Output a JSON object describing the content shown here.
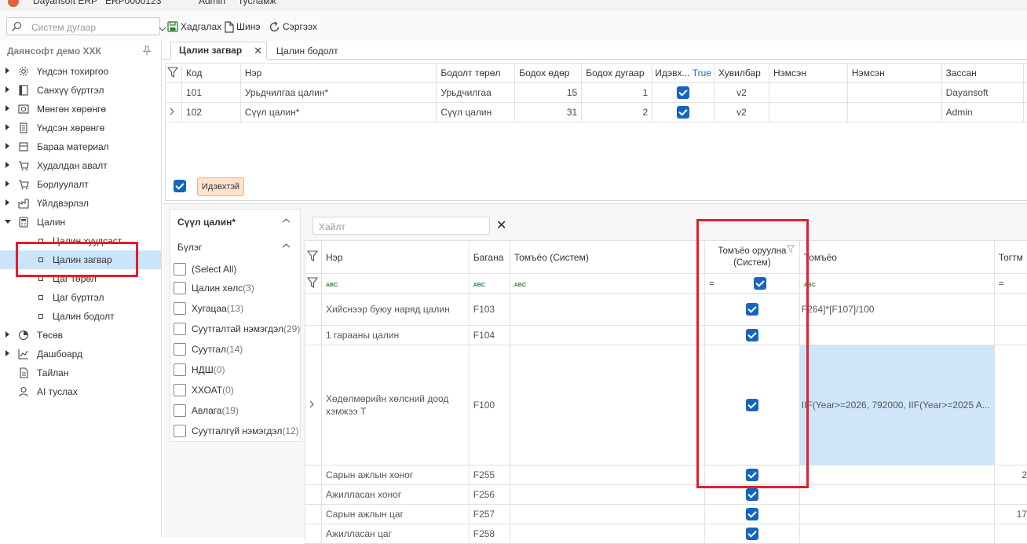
{
  "titlebar": {
    "app_name": "Dayansoft ERP",
    "document": "ERP0000123",
    "user": "Admin",
    "help": "Тусламж"
  },
  "toolbar": {
    "search_placeholder": "Систем дугаар",
    "save_label": "Хадгалах",
    "new_label": "Шинэ",
    "refresh_label": "Сэргээх"
  },
  "sidebar": {
    "company": "Даянсофт демо ХХК",
    "items": [
      {
        "label": "Үндсэн тохиргоо",
        "icon": "gear-icon"
      },
      {
        "label": "Санхүү бүртгэл",
        "icon": "book-icon"
      },
      {
        "label": "Мөнгөн хөрөнгө",
        "icon": "money-icon"
      },
      {
        "label": "Үндсэн хөрөнгө",
        "icon": "building-icon"
      },
      {
        "label": "Бараа материал",
        "icon": "box-icon"
      },
      {
        "label": "Худалдан авалт",
        "icon": "cart-icon"
      },
      {
        "label": "Борлуулалт",
        "icon": "cart-icon"
      },
      {
        "label": "Үйлдвэрлэл",
        "icon": "factory-icon"
      },
      {
        "label": "Цалин",
        "icon": "calculator-icon"
      }
    ],
    "salary_sub": [
      "Цалин хуудсаст",
      "Цалин загвар",
      "Цаг төрөл",
      "Цаг бүртгэл",
      "Цалин бодолт"
    ],
    "items_after": [
      {
        "label": "Төсөв",
        "icon": "pie-chart-icon"
      },
      {
        "label": "Дашбоард",
        "icon": "dashboard-icon"
      },
      {
        "label": "Тайлан",
        "icon": "report-icon"
      },
      {
        "label": "AI туслах",
        "icon": "ai-assistant-icon"
      }
    ]
  },
  "tabs": {
    "active": "Цалин загвар",
    "other": "Цалин бодолт"
  },
  "top_grid": {
    "headers": [
      "Код",
      "Нэр",
      "Бодолт төрөл",
      "Бодох өдөр",
      "Бодох дугаар",
      "Идэвх...",
      "True",
      "Хувилбар",
      "Нэмсэн",
      "Нэмсэн",
      "Зассан"
    ],
    "rows": [
      {
        "code": "101",
        "name": "Урьдчилгаа цалин*",
        "type": "Урьдчилгаа",
        "day": "15",
        "num": "1",
        "version": "v2",
        "editor": "Dayansoft"
      },
      {
        "code": "102",
        "name": "Сүүл цалин*",
        "type": "Сүүл цалин",
        "day": "31",
        "num": "2",
        "version": "v2",
        "editor": "Admin"
      }
    ],
    "filter_chip": "Идэвхтэй"
  },
  "filter_panel": {
    "title": "Сүүл цалин*",
    "group_label": "Бүлэг",
    "items": [
      {
        "label": "(Select All)",
        "count": ""
      },
      {
        "label": "Цалин хөлс",
        "count": "(3)"
      },
      {
        "label": "Хугацаа",
        "count": "(13)"
      },
      {
        "label": "Суутгалтай нэмэгдэл",
        "count": "(29)"
      },
      {
        "label": "Суутгал",
        "count": "(14)"
      },
      {
        "label": "НДШ",
        "count": "(0)"
      },
      {
        "label": "ХХОАТ",
        "count": "(0)"
      },
      {
        "label": "Авлага",
        "count": "(19)"
      },
      {
        "label": "Суутгалгүй нэмэгдэл",
        "count": "(12)"
      }
    ]
  },
  "lower_grid": {
    "search_placeholder": "Хайлт",
    "headers": {
      "name": "Нэр",
      "column": "Багана",
      "formula_sys": "Томъёо (Систем)",
      "formula_input_l1": "Томъёо оруулна",
      "formula_input_l2": "(Систем)",
      "formula": "Томъёо",
      "constant": "Тогтм"
    },
    "filter_abc": "ABC",
    "filter_eq": "=",
    "rows": [
      {
        "name": "Хийснээр буюу наряд цалин",
        "col": "F103",
        "formula": "F264]*[F107]/100",
        "extra": ""
      },
      {
        "name": "1 гарааны цалин",
        "col": "F104",
        "formula": "",
        "extra": ""
      },
      {
        "name_l1": "Хөдөлмөрийн хөлсний доод",
        "name_l2": "хэмжээ Т",
        "col": "F100",
        "formula": "IIF(Year>=2026, 792000, IIF(Year>=2025 A...",
        "extra": ""
      },
      {
        "name": "Сарын ажлын хоног",
        "col": "F255",
        "formula": "",
        "extra": "2"
      },
      {
        "name": "Ажилласан хоног",
        "col": "F256",
        "formula": "",
        "extra": ""
      },
      {
        "name": "Сарын ажлын цаг",
        "col": "F257",
        "formula": "",
        "extra": "17"
      },
      {
        "name": "Ажилласан цаг",
        "col": "F258",
        "formula": "",
        "extra": ""
      }
    ]
  },
  "colors": {
    "accent": "#1565c0",
    "highlight": "#e41e2b",
    "selection": "#cce4f7"
  }
}
